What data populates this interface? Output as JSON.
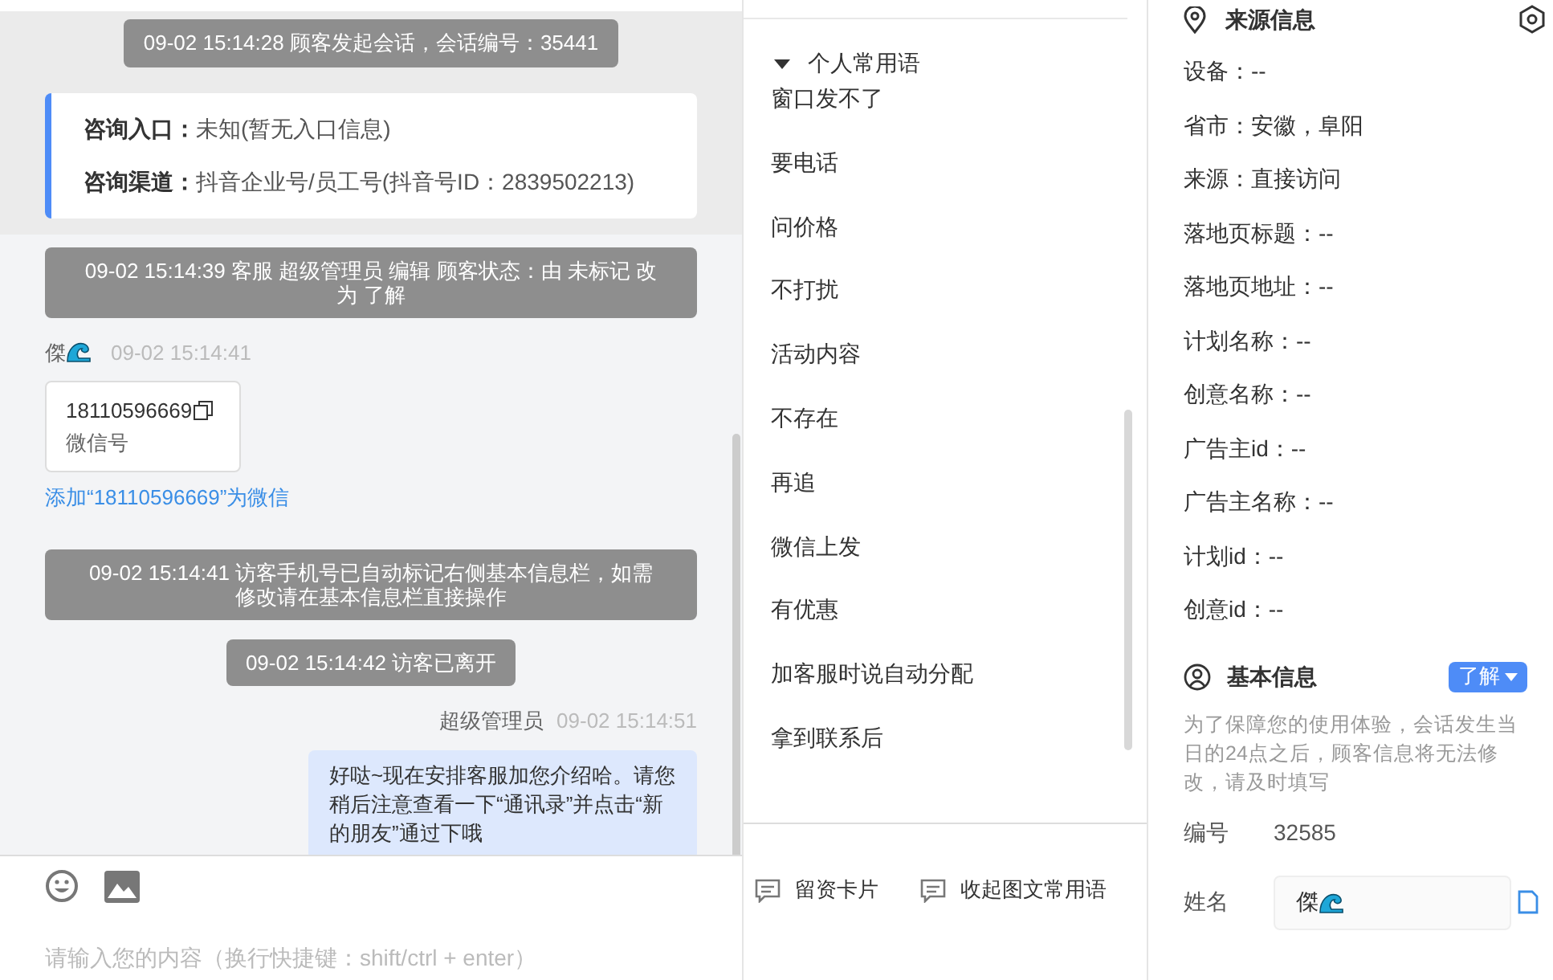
{
  "chat": {
    "messages": [
      {
        "kind": "system",
        "text": "09-02 15:14:28 顾客发起会话，会话编号：35441"
      },
      {
        "kind": "entry",
        "rows": [
          {
            "label": "咨询入口：",
            "value": "未知(暂无入口信息)"
          },
          {
            "label": "咨询渠道：",
            "value": "抖音企业号/员工号(抖音号ID：2839502213)"
          }
        ]
      },
      {
        "kind": "system",
        "text": "09-02 15:14:39 客服 超级管理员 编辑 顾客状态：由 未标记 改为 了解"
      },
      {
        "kind": "visitor",
        "sender": "傑",
        "time": "09-02 15:14:41",
        "card": {
          "number": "18110596669",
          "label": "微信号"
        }
      },
      {
        "kind": "link",
        "text": "添加“18110596669”为微信"
      },
      {
        "kind": "system",
        "text": "09-02 15:14:41 访客手机号已自动标记右侧基本信息栏，如需修改请在基本信息栏直接操作"
      },
      {
        "kind": "system",
        "text": "09-02 15:14:42 访客已离开"
      },
      {
        "kind": "agent",
        "sender": "超级管理员",
        "time": "09-02 15:14:51",
        "text": "好哒~现在安排客服加您介绍哈。请您稍后注意查看一下“通讯录”并点击“新的朋友”通过下哦"
      }
    ],
    "input": {
      "placeholder": "请输入您的内容（换行快捷键：shift/ctrl + enter）"
    }
  },
  "phrases": {
    "group": {
      "title": "个人常用语",
      "expanded": true,
      "items": [
        "窗口发不了",
        "要电话",
        "问价格",
        "不打扰",
        "活动内容",
        "不存在",
        "再追",
        "微信上发",
        "有优惠",
        "加客服时说自动分配",
        "拿到联系后"
      ]
    },
    "footer_buttons": [
      "留资卡片",
      "收起图文常用语"
    ]
  },
  "info": {
    "source": {
      "title": "来源信息",
      "fields": [
        "设备：--",
        "省市：安徽，阜阳",
        "来源：直接访问",
        "落地页标题：--",
        "落地页地址：--",
        "计划名称：--",
        "创意名称：--",
        "广告主id：--",
        "广告主名称：--",
        "计划id：--",
        "创意id：--"
      ]
    },
    "basic": {
      "title": "基本信息",
      "status_button": "了解",
      "notice": "为了保障您的使用体验，会话发生当日的24点之后，顾客信息将无法修改，请及时填写",
      "id_label": "编号",
      "id_value": "32585",
      "name_label": "姓名",
      "name_value": "傑"
    }
  }
}
